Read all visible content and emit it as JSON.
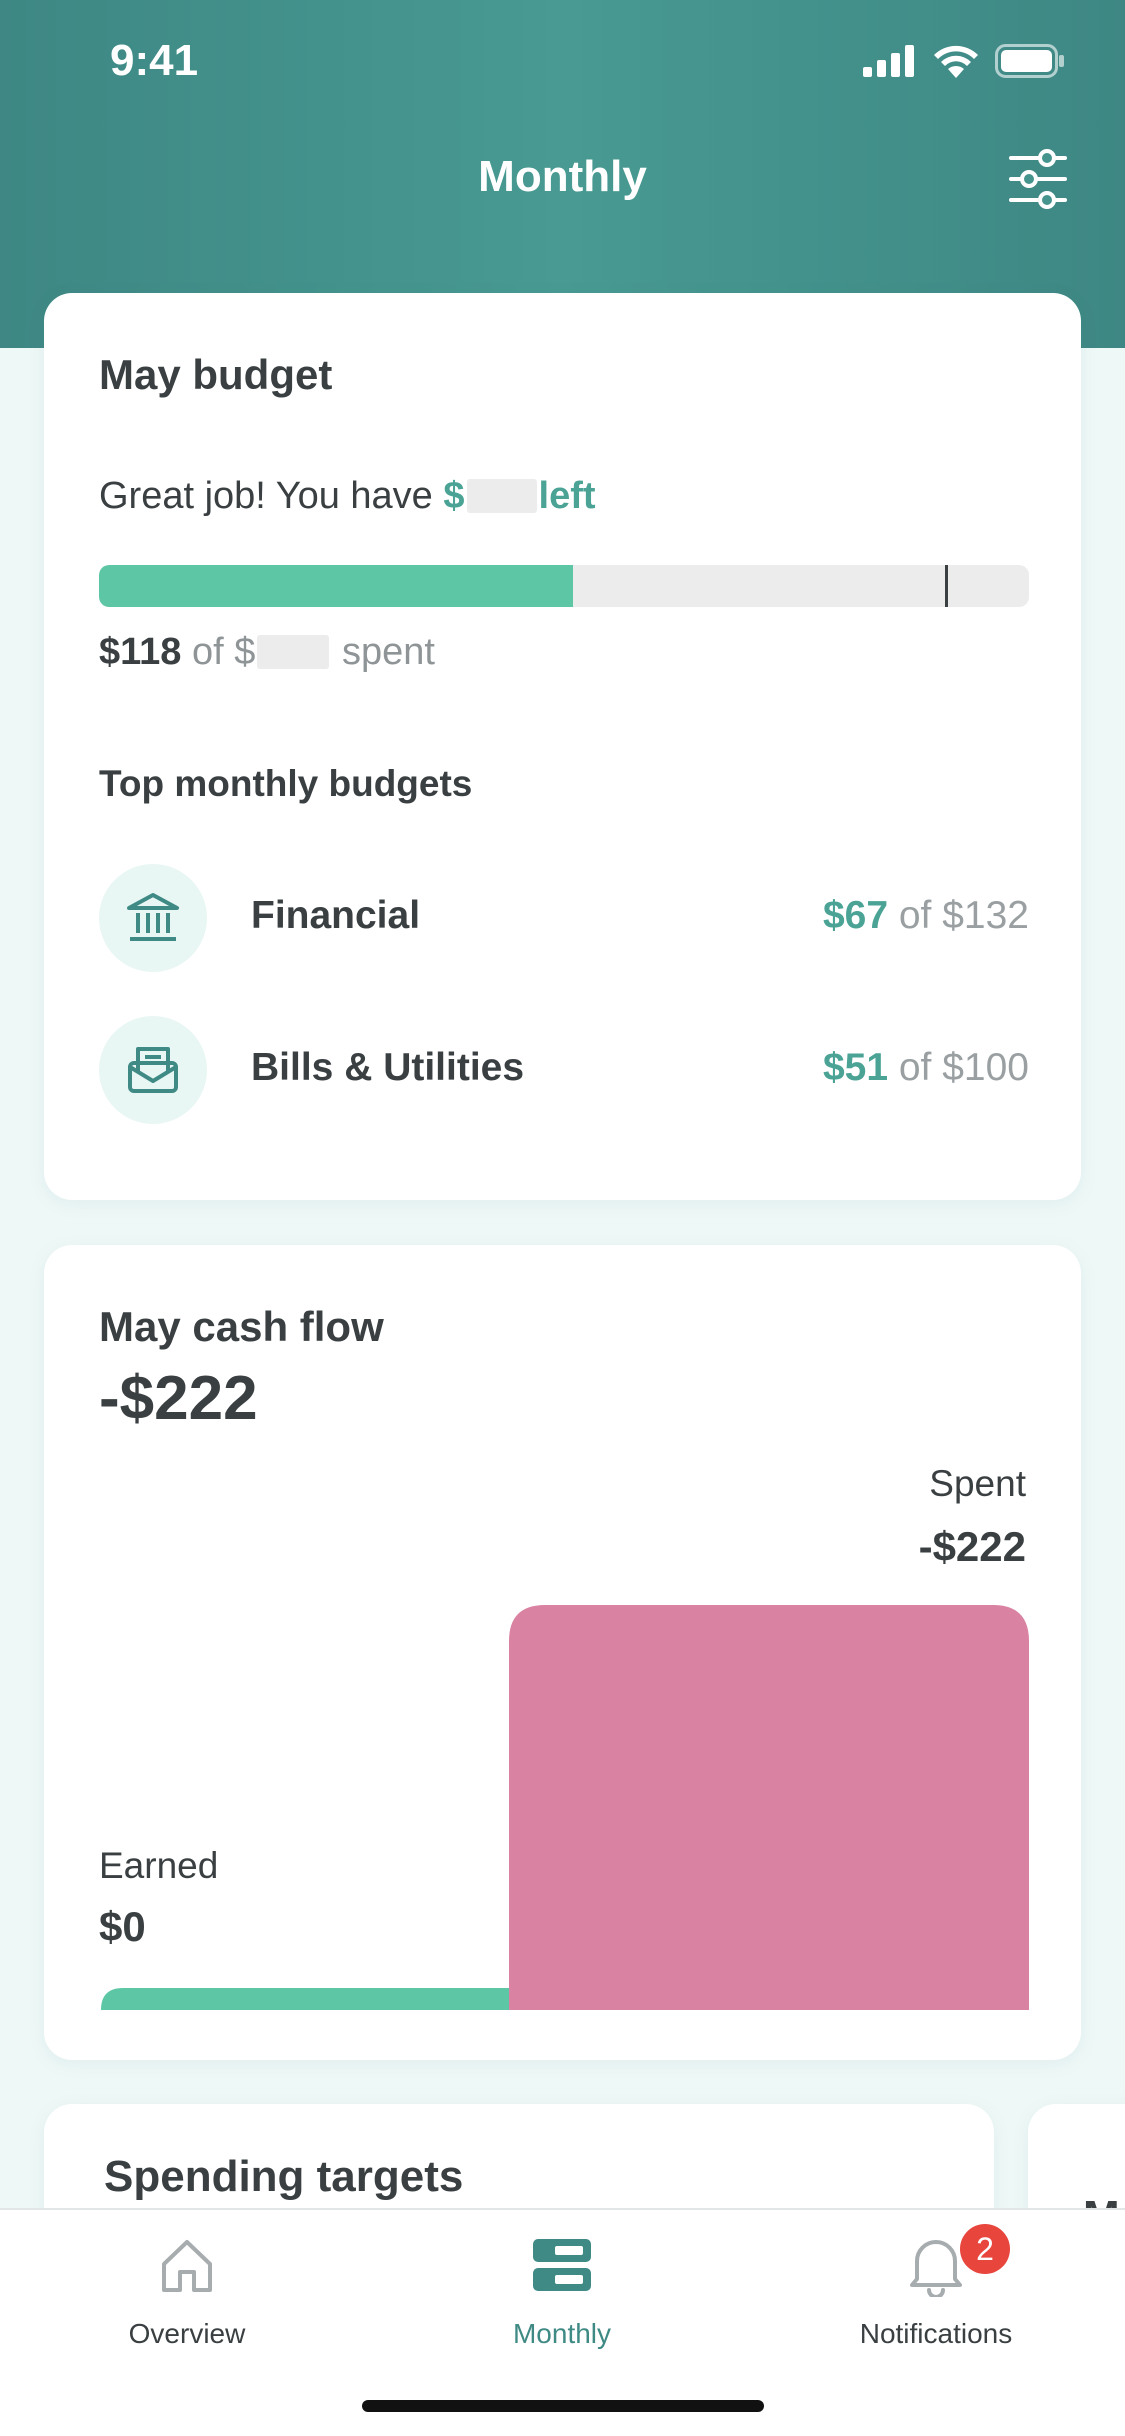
{
  "status_bar": {
    "time": "9:41"
  },
  "header": {
    "title": "Monthly"
  },
  "budget": {
    "title": "May budget",
    "message_prefix": "Great job! You have ",
    "message_amount_prefix": "$",
    "message_suffix": "left",
    "progress_spent_fraction": 0.51,
    "progress_marker_fraction": 0.91,
    "spent_amount": "$118",
    "spent_of": " of $",
    "spent_suffix": " spent",
    "section_title": "Top monthly budgets",
    "items": [
      {
        "icon": "bank-icon",
        "label": "Financial",
        "spent": "$67",
        "of": " of $132"
      },
      {
        "icon": "bills-envelope-icon",
        "label": "Bills & Utilities",
        "spent": "$51",
        "of": " of $100"
      }
    ]
  },
  "cash_flow": {
    "title": "May cash flow",
    "amount": "-$222",
    "earned": {
      "label": "Earned",
      "value": "$0",
      "amount": 0
    },
    "spent": {
      "label": "Spent",
      "value": "-$222",
      "amount": 222
    },
    "colors": {
      "earned": "#5cc6a5",
      "spent": "#d982a2"
    }
  },
  "spending_targets": {
    "title": "Spending targets"
  },
  "peek_card": {
    "letter": "M"
  },
  "tabs": [
    {
      "label": "Overview",
      "icon": "home-icon",
      "active": false
    },
    {
      "label": "Monthly",
      "icon": "monthly-icon",
      "active": true
    },
    {
      "label": "Notifications",
      "icon": "bell-icon",
      "active": false,
      "badge": "2"
    }
  ],
  "colors": {
    "accent": "#4aa395",
    "header": "#428f8a",
    "badge": "#e8453c"
  }
}
